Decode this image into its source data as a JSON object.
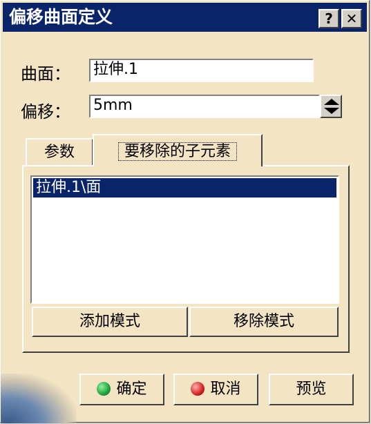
{
  "window": {
    "title": "偏移曲面定义",
    "help_label": "?",
    "close_label": "✕"
  },
  "form": {
    "surface": {
      "label": "曲面：",
      "value": "拉伸.1"
    },
    "offset": {
      "label": "偏移：",
      "value": "5mm"
    }
  },
  "tabs": [
    {
      "label": "参数"
    },
    {
      "label": "要移除的子元素"
    }
  ],
  "list": {
    "items": [
      "拉伸.1\\面"
    ]
  },
  "panel_buttons": {
    "add": "添加模式",
    "remove": "移除模式"
  },
  "footer": {
    "ok": "确定",
    "cancel": "取消",
    "preview": "预览"
  },
  "colors": {
    "title_bg": "#0a246a",
    "panel_bg": "#f3e4c4",
    "ok_dot": "#1fa23a",
    "cancel_dot": "#d42020"
  }
}
